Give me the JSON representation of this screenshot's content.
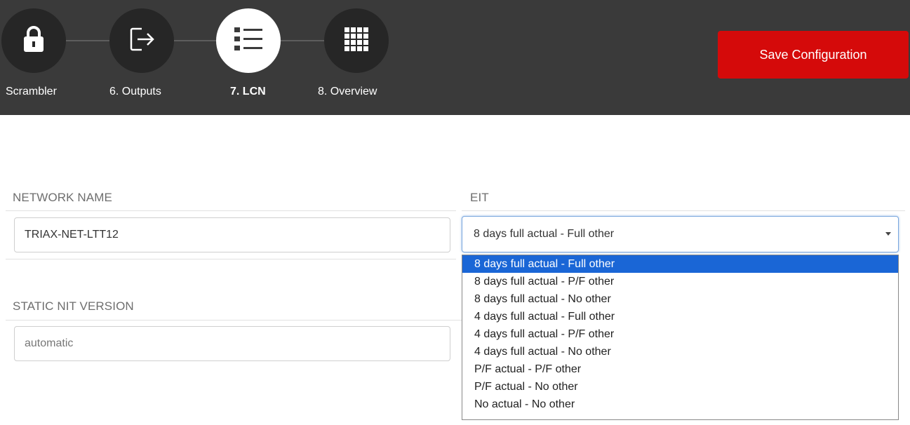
{
  "wizard": {
    "steps": [
      {
        "label": "Scrambler",
        "icon": "lock-icon"
      },
      {
        "label": "6. Outputs",
        "icon": "exit-arrow-icon"
      },
      {
        "label": "7. LCN",
        "icon": "list-icon"
      },
      {
        "label": "8. Overview",
        "icon": "grid-icon"
      }
    ],
    "active_step": "7. LCN"
  },
  "toolbar": {
    "save_label": "Save Configuration"
  },
  "form": {
    "network_name_label": "NETWORK NAME",
    "network_name_value": "TRIAX-NET-LTT12",
    "eit_label": "EIT",
    "eit_selected": "8 days full actual - Full other",
    "static_nit_label": "STATIC NIT VERSION",
    "static_nit_placeholder": "automatic"
  },
  "eit_options": [
    "8 days full actual - Full other",
    "8 days full actual - P/F other",
    "8 days full actual - No other",
    "4 days full actual - Full other",
    "4 days full actual - P/F other",
    "4 days full actual - No other",
    "P/F actual - P/F other",
    "P/F actual - No other",
    "No actual - No other"
  ],
  "colors": {
    "header_bg": "#3a3a3a",
    "save_button": "#d50a0a",
    "dropdown_highlight": "#1a66d6"
  }
}
